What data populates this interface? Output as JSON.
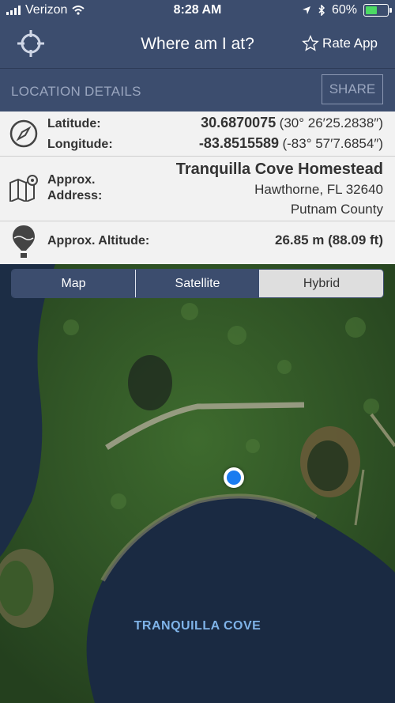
{
  "status_bar": {
    "carrier": "Verizon",
    "time": "8:28 AM",
    "battery_percent": "60%",
    "battery_level": 0.6
  },
  "nav": {
    "title": "Where am I at?",
    "rate_label": "Rate App"
  },
  "details": {
    "title": "LOCATION DETAILS",
    "share_label": "SHARE"
  },
  "coords": {
    "latitude_label": "Latitude:",
    "longitude_label": "Longitude:",
    "latitude_value": "30.6870075",
    "latitude_dms": "(30° 26′25.2838″)",
    "longitude_value": "-83.8515589",
    "longitude_dms": "(-83° 57′7.6854″)"
  },
  "address": {
    "label_line1": "Approx.",
    "label_line2": "Address:",
    "name": "Tranquilla Cove Homestead",
    "city": "Hawthorne, FL 32640",
    "county": "Putnam County"
  },
  "altitude": {
    "label": "Approx. Altitude:",
    "value": "26.85 m (88.09 ft)"
  },
  "map_types": {
    "options": [
      "Map",
      "Satellite",
      "Hybrid"
    ],
    "selected": "Hybrid"
  },
  "map": {
    "place_label": "TRANQUILLA COVE"
  },
  "colors": {
    "nav_bar": "#3c4d6e",
    "user_location": "#1a7cf0",
    "map_label": "#7fb3e8"
  }
}
